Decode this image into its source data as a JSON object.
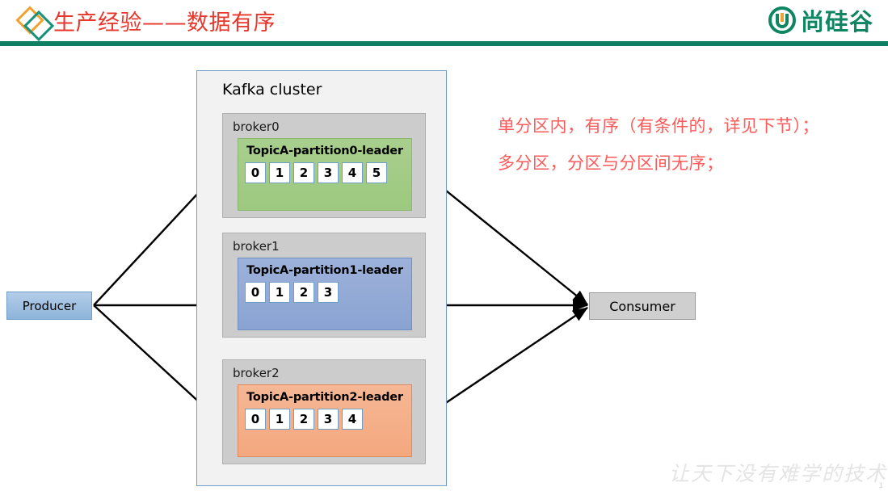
{
  "header": {
    "title": "生产经验——数据有序",
    "title_color": "#e8362b",
    "rule_color": "#0d8063",
    "logo_icon": "double-diamond-icon",
    "brand_icon": "u-circle-icon",
    "brand_text": "尚硅谷",
    "brand_color": "#0f8562",
    "diamond_orange": "#f0a22e",
    "diamond_teal": "#17917a"
  },
  "diagram": {
    "cluster": {
      "label": "Kafka cluster",
      "fill": "#f2f2f2",
      "border": "#6f9fc8"
    },
    "brokers": [
      {
        "label": "broker0",
        "partition_title": "TopicA-partition0-leader",
        "partition_color": "#9cc97f",
        "cells": [
          "0",
          "1",
          "2",
          "3",
          "4",
          "5"
        ]
      },
      {
        "label": "broker1",
        "partition_title": "TopicA-partition1-leader",
        "partition_color": "#8aa3d2",
        "cells": [
          "0",
          "1",
          "2",
          "3"
        ]
      },
      {
        "label": "broker2",
        "partition_title": "TopicA-partition2-leader",
        "partition_color": "#f4a87e",
        "cells": [
          "0",
          "1",
          "2",
          "3",
          "4"
        ]
      }
    ],
    "producer": {
      "label": "Producer",
      "fill": "#8eb4da",
      "border": "#6f9fc8"
    },
    "consumer": {
      "label": "Consumer",
      "fill": "#cfcfcf",
      "border": "#9a9a9a"
    },
    "arrow_color": "#000000"
  },
  "notes": {
    "color": "#fe5a5a",
    "lines": [
      "单分区内，有序（有条件的，详见下节）；",
      "多分区，分区与分区间无序；"
    ]
  },
  "watermark": {
    "text": "让天下没有难学的技术",
    "color": "#e4e4e4"
  },
  "page_number": "1"
}
